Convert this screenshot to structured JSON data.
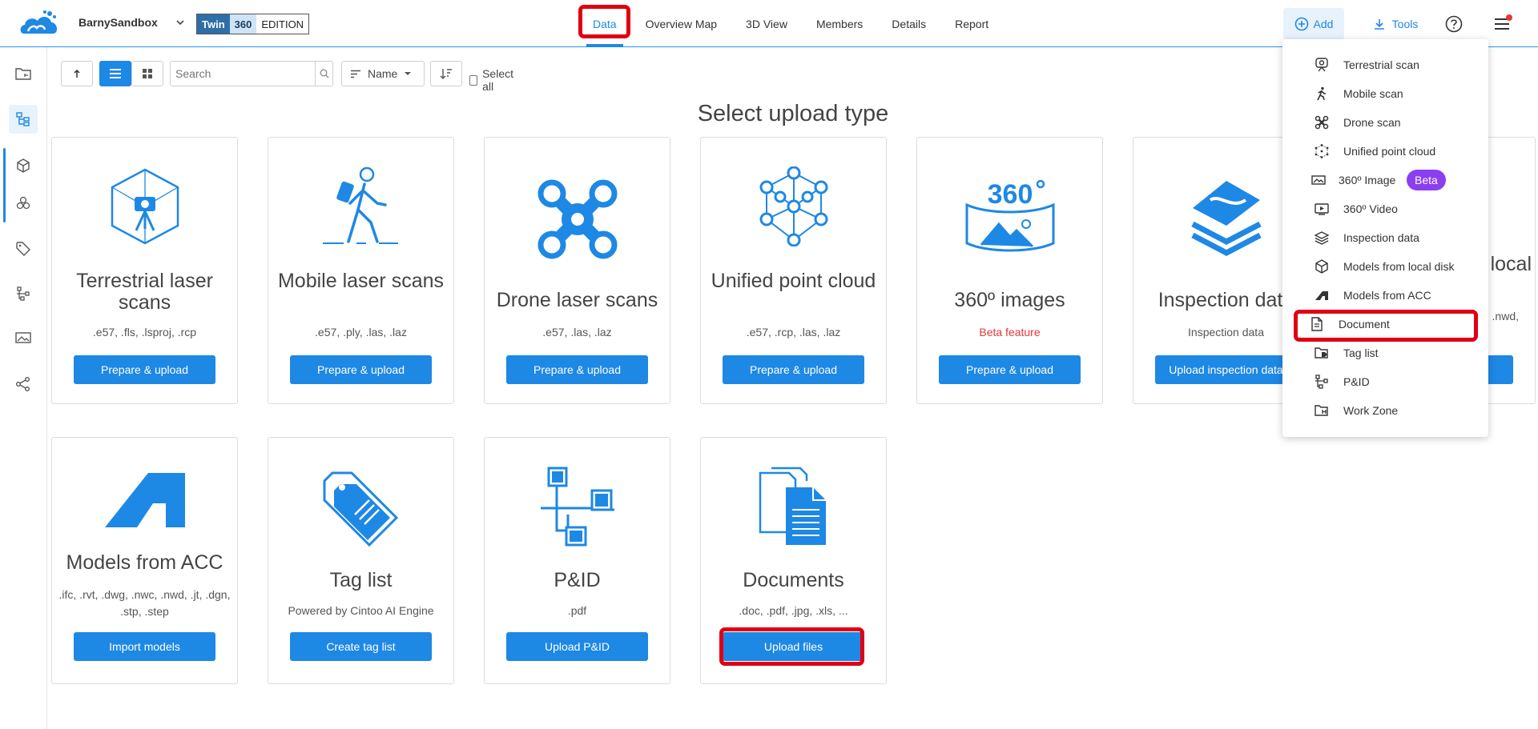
{
  "header": {
    "workspace_name": "BarnySandbox",
    "edition": {
      "part1": "Twin",
      "part2": "360",
      "part3": "EDITION"
    },
    "nav": [
      "Data",
      "Overview Map",
      "3D View",
      "Members",
      "Details",
      "Report"
    ],
    "active_nav": "Data",
    "add_label": "Add",
    "tools_label": "Tools"
  },
  "toolbar": {
    "search_placeholder": "Search",
    "sort_label": "Name",
    "select_all_label": "Select all"
  },
  "main": {
    "heading": "Select upload type",
    "cards": [
      {
        "title": "Terrestrial laser scans",
        "subtitle": ".e57, .fls, .lsproj, .rcp",
        "button": "Prepare & upload"
      },
      {
        "title": "Mobile laser scans",
        "subtitle": ".e57, .ply, .las, .laz",
        "button": "Prepare & upload"
      },
      {
        "title": "Drone laser scans",
        "subtitle": ".e57, .las, .laz",
        "button": "Prepare & upload"
      },
      {
        "title": "Unified point cloud",
        "subtitle": ".e57, .rcp, .las, .laz",
        "button": "Prepare & upload"
      },
      {
        "title": "360º images",
        "subtitle": "Beta feature",
        "button": "Prepare & upload"
      },
      {
        "title": "Inspection data",
        "subtitle": "Inspection data",
        "button": "Upload inspection data"
      },
      {
        "title": "Models from local",
        "subtitle": ".nwd,",
        "button": ""
      },
      {
        "title": "Models from ACC",
        "subtitle": ".ifc, .rvt, .dwg, .nwc, .nwd, .jt, .dgn, .stp, .step",
        "button": "Import models"
      },
      {
        "title": "Tag list",
        "subtitle": "Powered by Cintoo AI Engine",
        "button": "Create tag list"
      },
      {
        "title": "P&ID",
        "subtitle": ".pdf",
        "button": "Upload P&ID"
      },
      {
        "title": "Documents",
        "subtitle": ".doc, .pdf, .jpg, .xls, ...",
        "button": "Upload files"
      }
    ]
  },
  "add_menu": {
    "items": [
      {
        "label": "Terrestrial scan",
        "icon": "terrestrial-scan-icon"
      },
      {
        "label": "Mobile scan",
        "icon": "walker-icon"
      },
      {
        "label": "Drone scan",
        "icon": "drone-icon"
      },
      {
        "label": "Unified point cloud",
        "icon": "point-cloud-icon"
      },
      {
        "label": "360º Image",
        "icon": "panorama-image-icon",
        "badge": "Beta"
      },
      {
        "label": "360º Video",
        "icon": "panorama-video-icon"
      },
      {
        "label": "Inspection data",
        "icon": "layers-icon"
      },
      {
        "label": "Models from local disk",
        "icon": "cube-icon"
      },
      {
        "label": "Models from ACC",
        "icon": "acc-logo-icon"
      },
      {
        "label": "Document",
        "icon": "document-icon"
      },
      {
        "label": "Tag list",
        "icon": "tag-folder-icon"
      },
      {
        "label": "P&ID",
        "icon": "pid-diagram-icon"
      },
      {
        "label": "Work Zone",
        "icon": "work-zone-icon"
      }
    ]
  },
  "colors": {
    "accent": "#1e88e5",
    "highlight": "#e00012",
    "beta": "#8b3ff0",
    "beta_text": "#e53935"
  }
}
